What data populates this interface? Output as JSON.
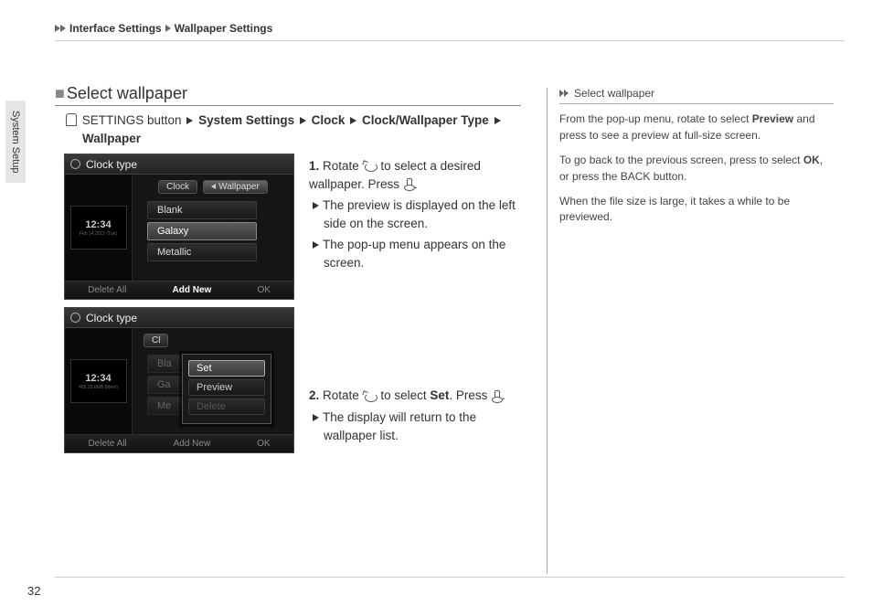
{
  "breadcrumb": {
    "item1": "Interface Settings",
    "item2": "Wallpaper Settings"
  },
  "side_tab": "System Setup",
  "section_title": "Select wallpaper",
  "nav_path": {
    "prefix": "SETTINGS button",
    "p1": "System Settings",
    "p2": "Clock",
    "p3": "Clock/Wallpaper Type",
    "p4": "Wallpaper"
  },
  "screen1": {
    "title": "Clock type",
    "tab_clock": "Clock",
    "tab_wallpaper": "Wallpaper",
    "opt_blank": "Blank",
    "opt_galaxy": "Galaxy",
    "opt_metallic": "Metallic",
    "time": "12:34",
    "date": "Feb 14,2012 (Tue)",
    "footer_delete": "Delete All",
    "footer_add": "Add New",
    "footer_ok": "OK"
  },
  "screen2": {
    "title": "Clock type",
    "tab_clock": "Cl",
    "opt_blank_partial": "Bla",
    "opt_gal_partial": "Ga",
    "opt_met_partial": "Me",
    "popup_set": "Set",
    "popup_preview": "Preview",
    "popup_delete": "Delete",
    "time": "12:34",
    "date": "465.25.0MB (Mem)",
    "footer_delete": "Delete All",
    "footer_add": "Add New",
    "footer_ok": "OK"
  },
  "steps": {
    "s1_num": "1.",
    "s1_a": "Rotate ",
    "s1_b": " to select a desired wallpaper. Press ",
    "s1_c": ".",
    "s1_sub1": "The preview is displayed on the left side on the screen.",
    "s1_sub2": "The pop-up menu appears on the screen.",
    "s2_num": "2.",
    "s2_a": "Rotate ",
    "s2_b": " to select ",
    "s2_set": "Set",
    "s2_c": ". Press ",
    "s2_d": ".",
    "s2_sub1": "The display will return to the wallpaper list."
  },
  "side": {
    "head": "Select wallpaper",
    "p1a": "From the pop-up menu, rotate to select ",
    "p1b": "Preview",
    "p1c": " and press to see a preview at full-size screen.",
    "p2a": "To go back to the previous screen, press to select ",
    "p2b": "OK",
    "p2c": ", or press the BACK button.",
    "p3": "When the file size is large, it takes a while to be previewed."
  },
  "page_num": "32"
}
